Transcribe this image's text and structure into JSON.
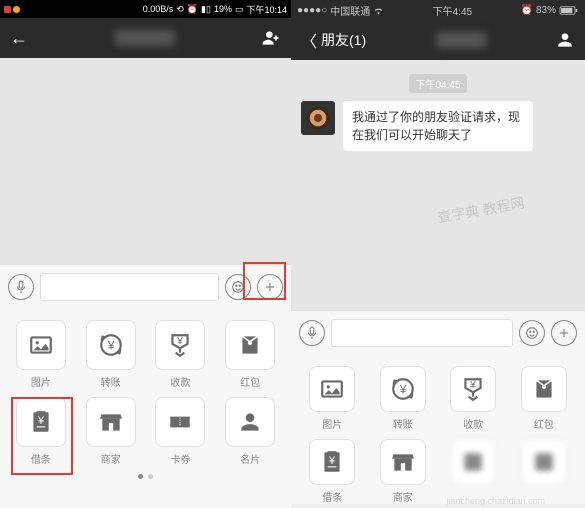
{
  "left": {
    "status": {
      "speed": "0.00B/s",
      "battery_pct": "19%",
      "time": "下午10:14"
    },
    "nav": {
      "back_glyph": "←"
    },
    "input": {
      "voice_name": "voice-icon",
      "emoji_name": "emoji-icon",
      "plus_name": "plus-icon"
    },
    "grid": [
      {
        "key": "photo",
        "label": "图片"
      },
      {
        "key": "transfer",
        "label": "转账"
      },
      {
        "key": "collect",
        "label": "收款"
      },
      {
        "key": "redpkt",
        "label": "红包"
      },
      {
        "key": "iou",
        "label": "借条"
      },
      {
        "key": "merchant",
        "label": "商家"
      },
      {
        "key": "coupon",
        "label": "卡券"
      },
      {
        "key": "card",
        "label": "名片"
      }
    ]
  },
  "right": {
    "status": {
      "carrier": "中国联通",
      "time": "下午4:45",
      "battery_pct": "83%"
    },
    "nav": {
      "back_glyph": "〈",
      "title": "朋友(1)"
    },
    "chat": {
      "time_pill": "下午04:45",
      "message": "我通过了你的朋友验证请求，现在我们可以开始聊天了"
    },
    "grid": [
      {
        "key": "photo",
        "label": "图片"
      },
      {
        "key": "transfer",
        "label": "转账"
      },
      {
        "key": "collect",
        "label": "收款"
      },
      {
        "key": "redpkt",
        "label": "红包"
      },
      {
        "key": "iou",
        "label": "借条"
      },
      {
        "key": "merchant",
        "label": "商家"
      },
      {
        "key": "blur1",
        "label": "　"
      },
      {
        "key": "blur2",
        "label": "　"
      }
    ]
  },
  "watermark": {
    "main": "查字典 教程网",
    "sub": "jiaocheng.chazidian.com"
  },
  "colors": {
    "highlight": "#e03c31"
  }
}
